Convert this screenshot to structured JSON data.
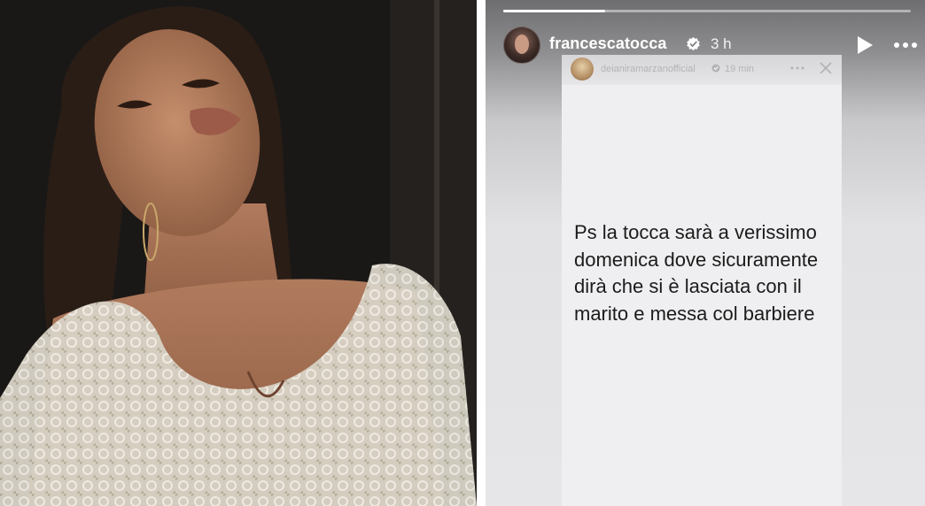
{
  "story": {
    "progress": 0.25,
    "username": "francescatocca",
    "time_ago": "3 h",
    "shared": {
      "username": "deianiramarzanofficial",
      "time_ago": "19 min",
      "text": "Ps la tocca sarà a verissimo domenica dove sicuramente dirà che si è lasciata con il marito e messa col barbiere"
    }
  },
  "icons": {
    "verified": "verified-badge-icon",
    "play": "play-icon",
    "more": "more-icon",
    "close": "close-icon"
  },
  "colors": {
    "text_white": "#ffffff",
    "story_text": "#1b1b1b"
  }
}
